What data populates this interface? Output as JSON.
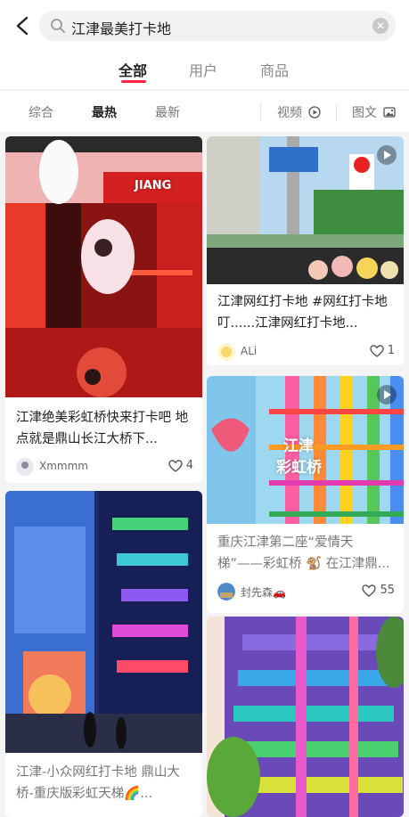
{
  "search": {
    "query": "江津最美打卡地"
  },
  "tabs": [
    {
      "label": "全部"
    },
    {
      "label": "用户"
    },
    {
      "label": "商品"
    }
  ],
  "filters": {
    "comprehensive": "综合",
    "hottest": "最热",
    "newest": "最新",
    "video": "视频",
    "image_text": "图文"
  },
  "colors": {
    "accent": "#ff2442"
  },
  "cards": [
    {
      "title": "江津绝美彩虹桥快来打卡吧 地点就是鼎山长江大桥下...",
      "author": "Xmmmm",
      "likes": "4",
      "overlay": "JIANG"
    },
    {
      "title": "江津网红打卡地 #网红打卡地  叮......江津网红打卡地...",
      "author": "ALi",
      "likes": "1"
    },
    {
      "title": "重庆江津第二座“爱情天梯”——彩虹桥 🐒 在江津鼎...",
      "author": "封先森🚗",
      "likes": "55",
      "overlay_line1": "江津",
      "overlay_line2": "彩虹桥"
    },
    {
      "title": "江津-小众网红打卡地 鼎山大桥-重庆版彩虹天梯🌈..."
    }
  ]
}
